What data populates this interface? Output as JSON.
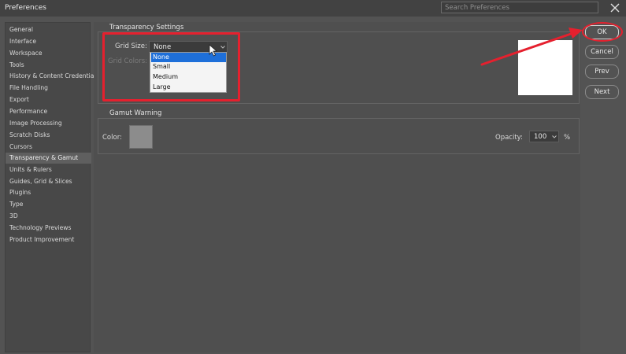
{
  "window": {
    "title": "Preferences"
  },
  "search": {
    "placeholder": "Search Preferences"
  },
  "sidebar": {
    "items": [
      {
        "label": "General"
      },
      {
        "label": "Interface"
      },
      {
        "label": "Workspace"
      },
      {
        "label": "Tools"
      },
      {
        "label": "History & Content Credentials"
      },
      {
        "label": "File Handling"
      },
      {
        "label": "Export"
      },
      {
        "label": "Performance"
      },
      {
        "label": "Image Processing"
      },
      {
        "label": "Scratch Disks"
      },
      {
        "label": "Cursors"
      },
      {
        "label": "Transparency & Gamut",
        "selected": true
      },
      {
        "label": "Units & Rulers"
      },
      {
        "label": "Guides, Grid & Slices"
      },
      {
        "label": "Plugins"
      },
      {
        "label": "Type"
      },
      {
        "label": "3D"
      },
      {
        "label": "Technology Previews"
      },
      {
        "label": "Product Improvement"
      }
    ]
  },
  "transparency": {
    "title": "Transparency Settings",
    "grid_size_label": "Grid Size:",
    "grid_size_value": "None",
    "grid_colors_label": "Grid Colors:",
    "options": [
      "None",
      "Small",
      "Medium",
      "Large"
    ],
    "highlighted_option": "None"
  },
  "gamut": {
    "title": "Gamut Warning",
    "color_label": "Color:",
    "opacity_label": "Opacity:",
    "opacity_value": "100",
    "opacity_unit": "%"
  },
  "buttons": {
    "ok": "OK",
    "cancel": "Cancel",
    "prev": "Prev",
    "next": "Next"
  },
  "colors": {
    "accent_red": "#e5202e",
    "selection_blue": "#1e6fd9"
  }
}
